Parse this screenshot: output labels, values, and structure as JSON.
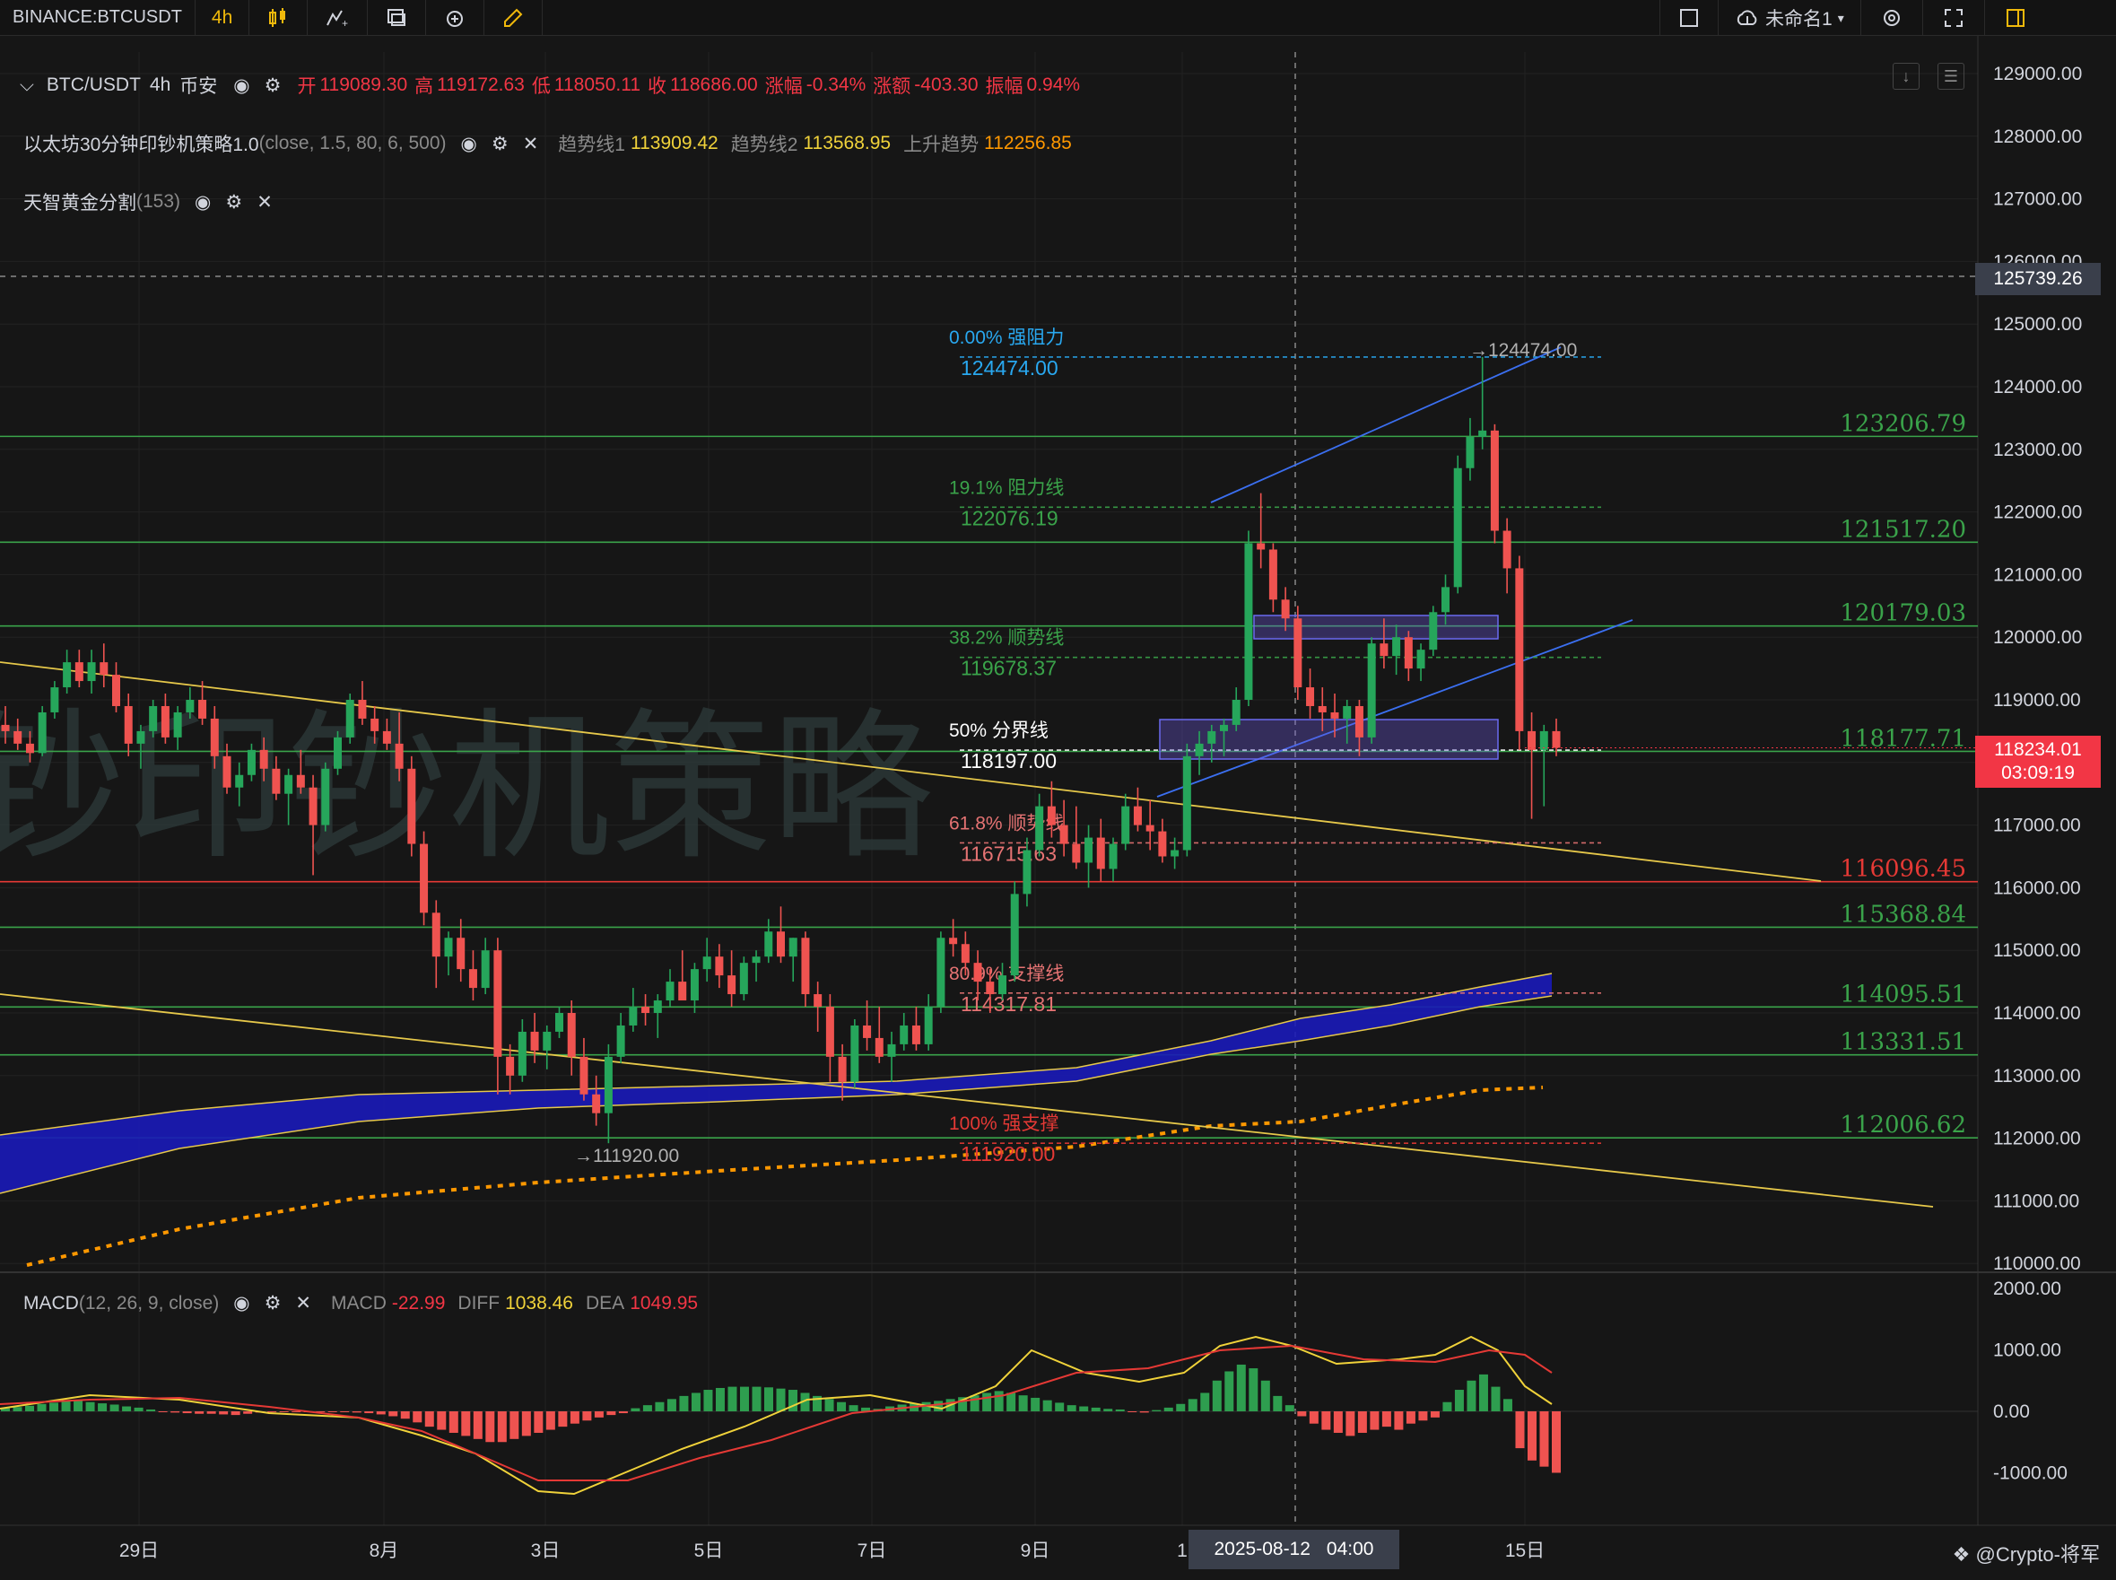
{
  "toolbar": {
    "symbol": "BINANCE:BTCUSDT",
    "interval": "4h",
    "layout_name": "未命名1"
  },
  "legend": {
    "main": {
      "symbol": "BTC/USDT",
      "interval": "4h",
      "exchange": "币安",
      "open_label": "开",
      "open": "119089.30",
      "high_label": "高",
      "high": "119172.63",
      "low_label": "低",
      "low": "118050.11",
      "close_label": "收",
      "close": "118686.00",
      "change_pct_label": "涨幅",
      "change_pct": "-0.34%",
      "change_label": "涨额",
      "change": "-403.30",
      "amplitude_label": "振幅",
      "amplitude": "0.94%"
    },
    "strategy": {
      "name": "以太坊30分钟印钞机策略1.0",
      "params": "(close, 1.5, 80, 6, 500)",
      "t1_label": "趋势线1",
      "t1": "113909.42",
      "t2_label": "趋势线2",
      "t2": "113568.95",
      "up_label": "上升趋势",
      "up": "112256.85"
    },
    "golden": {
      "name": "天智黄金分割",
      "params": "(153)"
    },
    "macd": {
      "name": "MACD",
      "params": "(12, 26, 9, close)",
      "macd_label": "MACD",
      "macd": "-22.99",
      "diff_label": "DIFF",
      "diff": "1038.46",
      "dea_label": "DEA",
      "dea": "1049.95"
    }
  },
  "price_axis": {
    "ticks": [
      "129000.00",
      "128000.00",
      "127000.00",
      "126000.00",
      "125000.00",
      "124000.00",
      "123000.00",
      "122000.00",
      "121000.00",
      "120000.00",
      "119000.00",
      "118000.00",
      "117000.00",
      "116000.00",
      "115000.00",
      "114000.00",
      "113000.00",
      "112000.00",
      "111000.00",
      "110000.00"
    ],
    "crosshair_price": "125739.26",
    "last_price": "118234.01",
    "countdown": "03:09:19"
  },
  "macd_axis": {
    "ticks": [
      "2000.00",
      "1000.00",
      "0.00",
      "-1000.00"
    ]
  },
  "time_axis": {
    "labels": [
      "29日",
      "8月",
      "3日",
      "5日",
      "7日",
      "9日",
      "1",
      "15日"
    ],
    "crosshair_date": "2025-08-12",
    "crosshair_time": "04:00"
  },
  "levels": [
    "123206.79",
    "121517.20",
    "120179.03",
    "118177.71",
    "116096.45",
    "115368.84",
    "114095.51",
    "113331.51",
    "112006.62"
  ],
  "fib": [
    {
      "pct": "0.00% 强阻力",
      "value": "124474.00"
    },
    {
      "pct": "19.1% 阻力线",
      "value": "122076.19"
    },
    {
      "pct": "38.2% 顺势线",
      "value": "119678.37"
    },
    {
      "pct": "50% 分界线",
      "value": "118197.00"
    },
    {
      "pct": "61.8% 顺势线",
      "value": "116715.63"
    },
    {
      "pct": "80.9% 支撑线",
      "value": "114317.81"
    },
    {
      "pct": "100% 强支撑",
      "value": "111920.00"
    }
  ],
  "annotations": {
    "high": "→124474.00",
    "low": "→111920.00"
  },
  "watermark": "钞印钞机策略",
  "credit": "@Crypto-将军",
  "colors": {
    "up": "#26a65b",
    "down": "#ef5350",
    "band": "#1a1ab8",
    "trend": "#e6c84a",
    "fib_top": "#29a8f0"
  },
  "chart_data": {
    "type": "candlestick",
    "interval": "4h",
    "ylim": [
      110000,
      129000
    ],
    "candles_ohlc": [
      [
        118600,
        118900,
        118300,
        118500
      ],
      [
        118500,
        118700,
        118200,
        118300
      ],
      [
        118300,
        118500,
        118000,
        118150
      ],
      [
        118150,
        118900,
        118100,
        118800
      ],
      [
        118800,
        119300,
        118700,
        119200
      ],
      [
        119200,
        119800,
        119100,
        119600
      ],
      [
        119600,
        119800,
        119200,
        119300
      ],
      [
        119300,
        119800,
        119100,
        119600
      ],
      [
        119600,
        119900,
        119200,
        119400
      ],
      [
        119400,
        119600,
        118800,
        118900
      ],
      [
        118900,
        119100,
        118100,
        118300
      ],
      [
        118300,
        118600,
        117900,
        118500
      ],
      [
        118500,
        119000,
        118400,
        118900
      ],
      [
        118900,
        119100,
        118300,
        118400
      ],
      [
        118400,
        118900,
        118200,
        118800
      ],
      [
        118800,
        119200,
        118700,
        119000
      ],
      [
        119000,
        119300,
        118600,
        118700
      ],
      [
        118700,
        118900,
        117900,
        118100
      ],
      [
        118100,
        118300,
        117500,
        117600
      ],
      [
        117600,
        118000,
        117300,
        117800
      ],
      [
        117800,
        118300,
        117700,
        118200
      ],
      [
        118200,
        118400,
        117700,
        117900
      ],
      [
        117900,
        118100,
        117400,
        117500
      ],
      [
        117500,
        117900,
        117000,
        117800
      ],
      [
        117800,
        118200,
        117500,
        117600
      ],
      [
        117600,
        117800,
        116200,
        117000
      ],
      [
        117000,
        118000,
        116900,
        117900
      ],
      [
        117900,
        118500,
        117800,
        118400
      ],
      [
        118400,
        119100,
        118300,
        119000
      ],
      [
        119000,
        119300,
        118600,
        118700
      ],
      [
        118700,
        118900,
        118300,
        118500
      ],
      [
        118500,
        118700,
        118200,
        118300
      ],
      [
        118300,
        118800,
        117700,
        117900
      ],
      [
        117900,
        118100,
        116500,
        116700
      ],
      [
        116700,
        116900,
        115400,
        115600
      ],
      [
        115600,
        115800,
        114400,
        114900
      ],
      [
        114900,
        115300,
        114600,
        115200
      ],
      [
        115200,
        115500,
        114500,
        114700
      ],
      [
        114700,
        115000,
        114200,
        114400
      ],
      [
        114400,
        115200,
        114300,
        115000
      ],
      [
        115000,
        115200,
        112700,
        113300
      ],
      [
        113300,
        113500,
        112700,
        113000
      ],
      [
        113000,
        113900,
        112900,
        113700
      ],
      [
        113700,
        114000,
        113200,
        113400
      ],
      [
        113400,
        113800,
        113100,
        113700
      ],
      [
        113700,
        114100,
        113600,
        114000
      ],
      [
        114000,
        114200,
        113000,
        113300
      ],
      [
        113300,
        113600,
        112600,
        112700
      ],
      [
        112700,
        113000,
        112200,
        112400
      ],
      [
        112400,
        113500,
        111920,
        113300
      ],
      [
        113300,
        114000,
        113200,
        113800
      ],
      [
        113800,
        114400,
        113700,
        114100
      ],
      [
        114100,
        114300,
        113800,
        114000
      ],
      [
        114000,
        114300,
        113600,
        114200
      ],
      [
        114200,
        114700,
        114100,
        114500
      ],
      [
        114500,
        115000,
        114400,
        114200
      ],
      [
        114200,
        114800,
        114000,
        114700
      ],
      [
        114700,
        115200,
        114500,
        114900
      ],
      [
        114900,
        115100,
        114400,
        114600
      ],
      [
        114600,
        115000,
        114100,
        114300
      ],
      [
        114300,
        114900,
        114200,
        114800
      ],
      [
        114800,
        115000,
        114500,
        114900
      ],
      [
        114900,
        115500,
        114800,
        115300
      ],
      [
        115300,
        115700,
        114800,
        114900
      ],
      [
        114900,
        115200,
        114500,
        115200
      ],
      [
        115200,
        115300,
        114100,
        114300
      ],
      [
        114300,
        114500,
        113700,
        114100
      ],
      [
        114100,
        114300,
        112900,
        113300
      ],
      [
        113300,
        113500,
        112600,
        112900
      ],
      [
        112900,
        113900,
        112800,
        113800
      ],
      [
        113800,
        114200,
        113400,
        113600
      ],
      [
        113600,
        114100,
        113200,
        113300
      ],
      [
        113300,
        113700,
        112900,
        113500
      ],
      [
        113500,
        114000,
        113400,
        113800
      ],
      [
        113800,
        114100,
        113400,
        113500
      ],
      [
        113500,
        114300,
        113400,
        114100
      ],
      [
        114100,
        115300,
        114000,
        115200
      ],
      [
        115200,
        115500,
        114900,
        115100
      ],
      [
        115100,
        115300,
        114600,
        114800
      ],
      [
        114800,
        115000,
        114200,
        114500
      ],
      [
        114500,
        114700,
        114000,
        114300
      ],
      [
        114300,
        114800,
        114200,
        114600
      ],
      [
        114600,
        116100,
        114500,
        115900
      ],
      [
        115900,
        116800,
        115700,
        116600
      ],
      [
        116600,
        117500,
        116500,
        117300
      ],
      [
        117300,
        117700,
        116800,
        117000
      ],
      [
        117000,
        117400,
        116500,
        116700
      ],
      [
        116700,
        117300,
        116300,
        116400
      ],
      [
        116400,
        117000,
        116000,
        116800
      ],
      [
        116800,
        117100,
        116100,
        116300
      ],
      [
        116300,
        116800,
        116100,
        116700
      ],
      [
        116700,
        117500,
        116600,
        117300
      ],
      [
        117300,
        117600,
        116900,
        117000
      ],
      [
        117000,
        117400,
        116600,
        116900
      ],
      [
        116900,
        117100,
        116400,
        116500
      ],
      [
        116500,
        116800,
        116300,
        116600
      ],
      [
        116600,
        118300,
        116500,
        118100
      ],
      [
        118100,
        118500,
        117800,
        118300
      ],
      [
        118300,
        118600,
        118000,
        118500
      ],
      [
        118500,
        118700,
        118100,
        118600
      ],
      [
        118600,
        119200,
        118500,
        119000
      ],
      [
        119000,
        121700,
        118900,
        121500
      ],
      [
        121500,
        122300,
        121100,
        121400
      ],
      [
        121400,
        121500,
        120400,
        120600
      ],
      [
        120600,
        120800,
        120100,
        120300
      ],
      [
        120300,
        120500,
        119000,
        119200
      ],
      [
        119200,
        119500,
        118700,
        118900
      ],
      [
        118900,
        119200,
        118500,
        118800
      ],
      [
        118800,
        119100,
        118400,
        118700
      ],
      [
        118700,
        119000,
        118300,
        118900
      ],
      [
        118900,
        119000,
        118100,
        118400
      ],
      [
        118400,
        120000,
        118300,
        119900
      ],
      [
        119900,
        120300,
        119500,
        119700
      ],
      [
        119700,
        120200,
        119400,
        120000
      ],
      [
        120000,
        120100,
        119300,
        119500
      ],
      [
        119500,
        119900,
        119300,
        119800
      ],
      [
        119800,
        120500,
        119700,
        120400
      ],
      [
        120400,
        121000,
        120200,
        120800
      ],
      [
        120800,
        122900,
        120700,
        122700
      ],
      [
        122700,
        123500,
        122500,
        123200
      ],
      [
        123200,
        124474,
        123000,
        123300
      ],
      [
        123300,
        123400,
        121500,
        121700
      ],
      [
        121700,
        121900,
        120700,
        121100
      ],
      [
        121100,
        121300,
        118200,
        118500
      ],
      [
        118500,
        118800,
        117100,
        118200
      ],
      [
        118200,
        118600,
        117300,
        118500
      ],
      [
        118500,
        118700,
        118100,
        118234
      ]
    ]
  }
}
